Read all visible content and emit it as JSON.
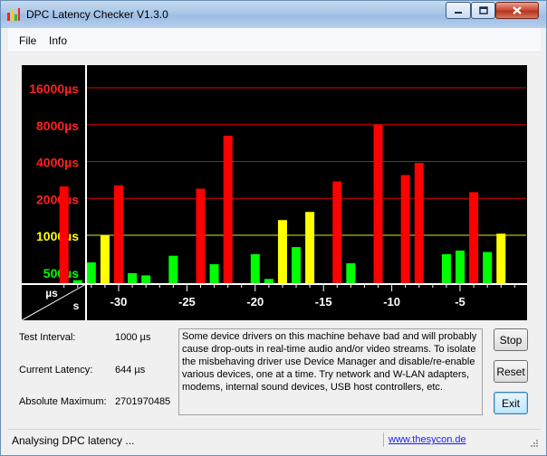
{
  "window": {
    "title": "DPC Latency Checker V1.3.0"
  },
  "menu": {
    "file": "File",
    "info": "Info"
  },
  "chart_data": {
    "type": "bar",
    "y_labels": [
      {
        "text": "16000µs",
        "color": "#ff2020",
        "value": 16000
      },
      {
        "text": "8000µs",
        "color": "#ff2020",
        "value": 8000
      },
      {
        "text": "4000µs",
        "color": "#ff2020",
        "value": 4000
      },
      {
        "text": "2000µs",
        "color": "#ff2020",
        "value": 2000
      },
      {
        "text": "1000µs",
        "color": "#ffff00",
        "value": 1000
      },
      {
        "text": "500µs",
        "color": "#00ff00",
        "value": 500
      }
    ],
    "corner": {
      "top": "µs",
      "bottom": "s"
    },
    "x_ticks": [
      "-30",
      "-25",
      "-20",
      "-15",
      "-10",
      "-5"
    ],
    "x_tick_values": [
      -30,
      -25,
      -20,
      -15,
      -10,
      -5
    ],
    "bars": [
      {
        "t": -34,
        "value": 2500,
        "color": "red"
      },
      {
        "t": -33,
        "value": 430,
        "color": "green"
      },
      {
        "t": -32,
        "value": 600,
        "color": "green"
      },
      {
        "t": -31,
        "value": 1000,
        "color": "yellow"
      },
      {
        "t": -30,
        "value": 2550,
        "color": "red"
      },
      {
        "t": -29,
        "value": 490,
        "color": "green"
      },
      {
        "t": -28,
        "value": 470,
        "color": "green"
      },
      {
        "t": -27,
        "value": 270,
        "color": "green"
      },
      {
        "t": -26,
        "value": 680,
        "color": "green"
      },
      {
        "t": -25,
        "value": 285,
        "color": "green"
      },
      {
        "t": -24,
        "value": 2400,
        "color": "red"
      },
      {
        "t": -23,
        "value": 580,
        "color": "green"
      },
      {
        "t": -22,
        "value": 6500,
        "color": "red"
      },
      {
        "t": -21,
        "value": 320,
        "color": "green"
      },
      {
        "t": -20,
        "value": 700,
        "color": "green"
      },
      {
        "t": -19,
        "value": 440,
        "color": "green"
      },
      {
        "t": -18,
        "value": 1330,
        "color": "yellow"
      },
      {
        "t": -17,
        "value": 800,
        "color": "green"
      },
      {
        "t": -16,
        "value": 1550,
        "color": "yellow"
      },
      {
        "t": -15,
        "value": 370,
        "color": "green"
      },
      {
        "t": -14,
        "value": 2750,
        "color": "red"
      },
      {
        "t": -13,
        "value": 590,
        "color": "green"
      },
      {
        "t": -12,
        "value": 370,
        "color": "green"
      },
      {
        "t": -11,
        "value": 8000,
        "color": "red"
      },
      {
        "t": -10,
        "value": 280,
        "color": "green"
      },
      {
        "t": -9,
        "value": 3100,
        "color": "red"
      },
      {
        "t": -8,
        "value": 3900,
        "color": "red"
      },
      {
        "t": -7,
        "value": 280,
        "color": "green"
      },
      {
        "t": -6,
        "value": 700,
        "color": "green"
      },
      {
        "t": -5,
        "value": 750,
        "color": "green"
      },
      {
        "t": -4,
        "value": 2250,
        "color": "red"
      },
      {
        "t": -3,
        "value": 730,
        "color": "green"
      },
      {
        "t": -2,
        "value": 1030,
        "color": "yellow"
      }
    ],
    "colors": {
      "red": "#ff0000",
      "green": "#00ff00",
      "yellow": "#ffff00",
      "gridRed": "#e00000",
      "gridYellow": "#e6e600",
      "background": "#000000",
      "axis": "#ffffff"
    }
  },
  "stats": {
    "test_interval_label": "Test Interval:",
    "test_interval_value": "1000 µs",
    "current_latency_label": "Current Latency:",
    "current_latency_value": "644 µs",
    "absolute_max_label": "Absolute Maximum:",
    "absolute_max_value": "2701970485"
  },
  "description": "Some device drivers on this machine behave bad and will probably cause drop-outs in real-time audio and/or video streams. To isolate the misbehaving driver use Device Manager and disable/re-enable various devices, one at a time. Try network and W-LAN adapters, modems, internal sound devices, USB host controllers, etc.",
  "buttons": {
    "stop": "Stop",
    "reset": "Reset",
    "exit": "Exit"
  },
  "status": {
    "text": "Analysing DPC latency ...",
    "link": "www.thesycon.de"
  },
  "icons": {
    "app": "bar-chart-icon",
    "minimize": "minimize-icon",
    "maximize": "maximize-icon",
    "close": "close-icon",
    "grip": "resize-grip-icon"
  }
}
